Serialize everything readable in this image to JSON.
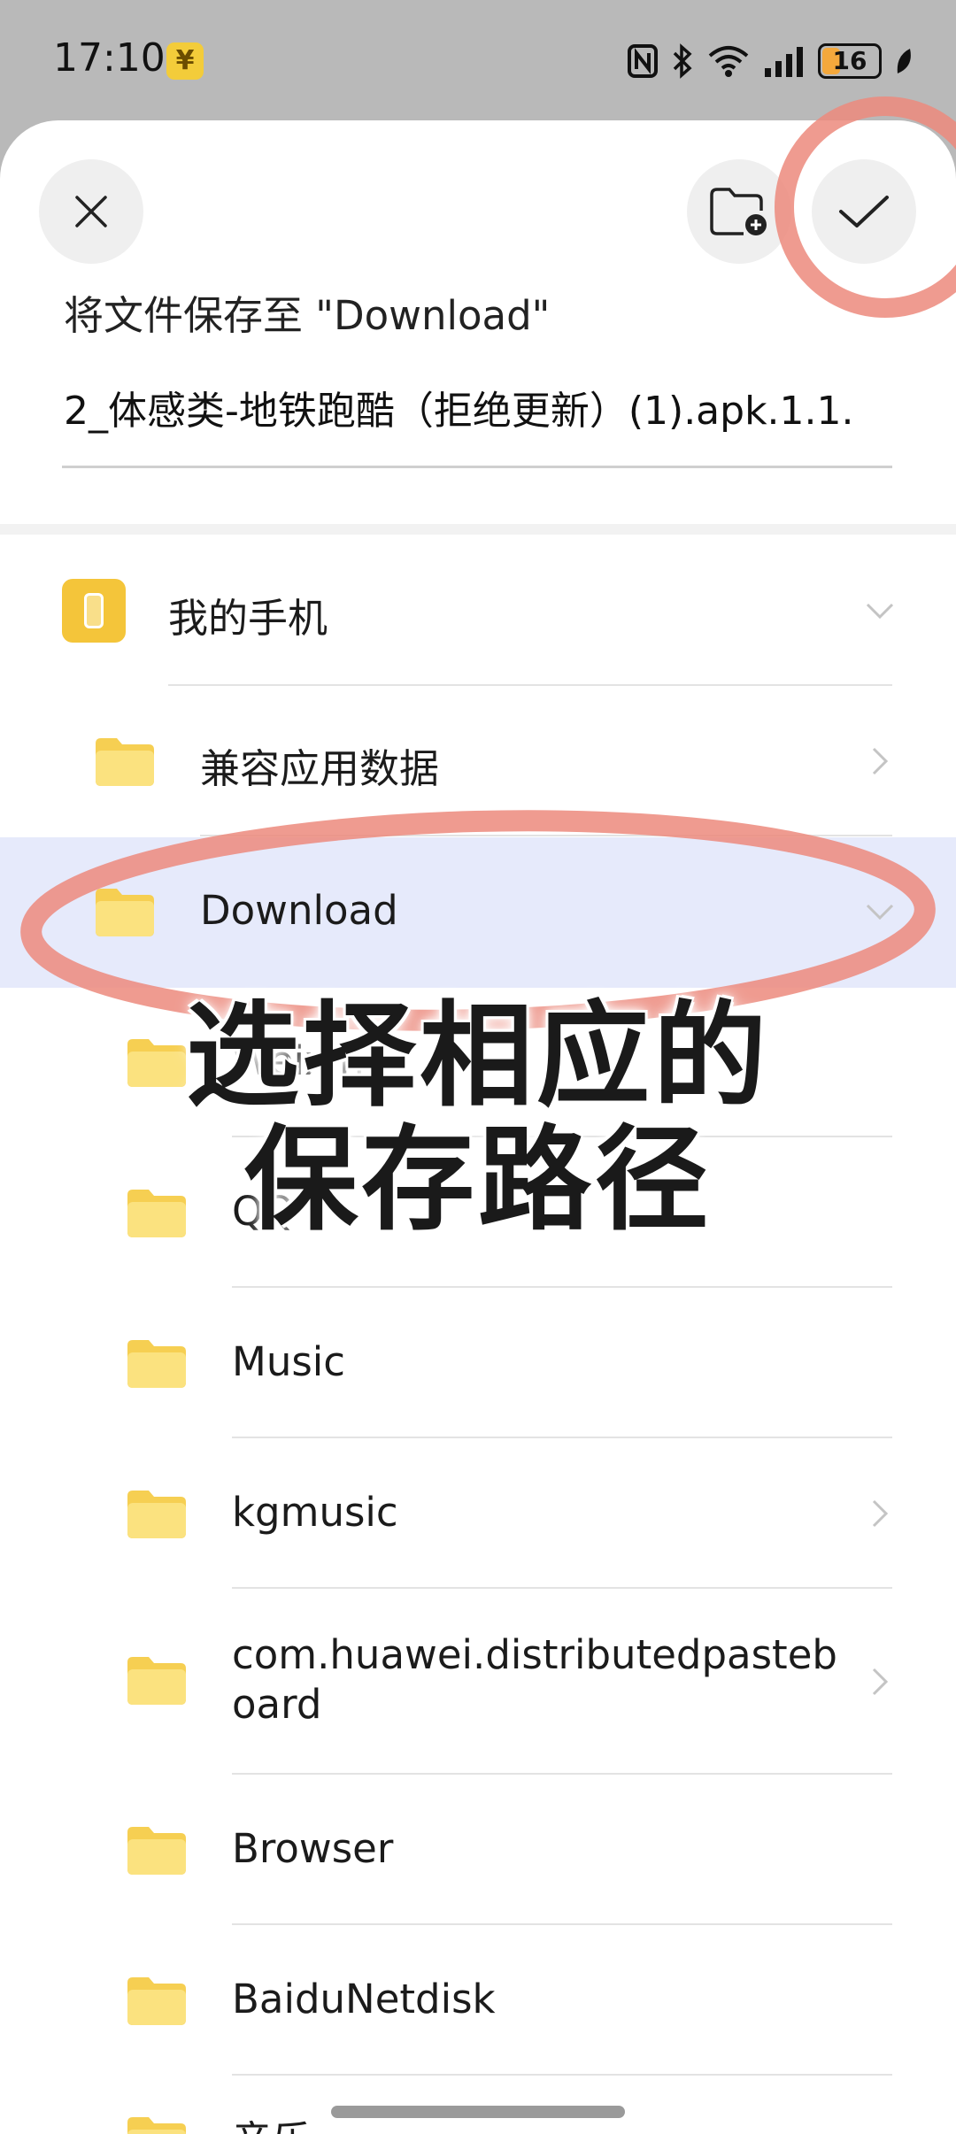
{
  "status_bar": {
    "time": "17:10",
    "app_badge": "¥",
    "icons": [
      "nfc-icon",
      "bluetooth-icon",
      "wifi-icon",
      "signal-icon"
    ],
    "battery": "16",
    "battery_color": "#f4a83c"
  },
  "header": {
    "close_icon": "close-icon",
    "new_folder_icon": "new-folder-icon",
    "confirm_icon": "check-icon",
    "save_title": "将文件保存至 \"Download\"",
    "filename": "2_体感类-地铁跑酷（拒绝更新）(1).apk.1.1."
  },
  "tree": {
    "root": {
      "label": "我的手机",
      "expanded": true
    },
    "items": [
      {
        "label": "兼容应用数据",
        "chevron": "right"
      },
      {
        "label": "Download",
        "chevron": "down",
        "selected": true
      },
      {
        "label": "Weixin",
        "chevron": ""
      },
      {
        "label": "QQ",
        "chevron": ""
      },
      {
        "label": "Music",
        "chevron": ""
      },
      {
        "label": "kgmusic",
        "chevron": "right"
      },
      {
        "label": "com.huawei.distributedpasteboard",
        "chevron": "right"
      },
      {
        "label": "Browser",
        "chevron": ""
      },
      {
        "label": "BaiduNetdisk",
        "chevron": ""
      },
      {
        "label": "音乐",
        "chevron": ""
      }
    ]
  },
  "annotation": {
    "line1": "选择相应的",
    "line2": "保存路径",
    "circle_color": "#ec8a7c"
  },
  "colors": {
    "folder": "#f6cf52",
    "selected_row": "#e6eafb",
    "divider": "#e3e3e3"
  }
}
